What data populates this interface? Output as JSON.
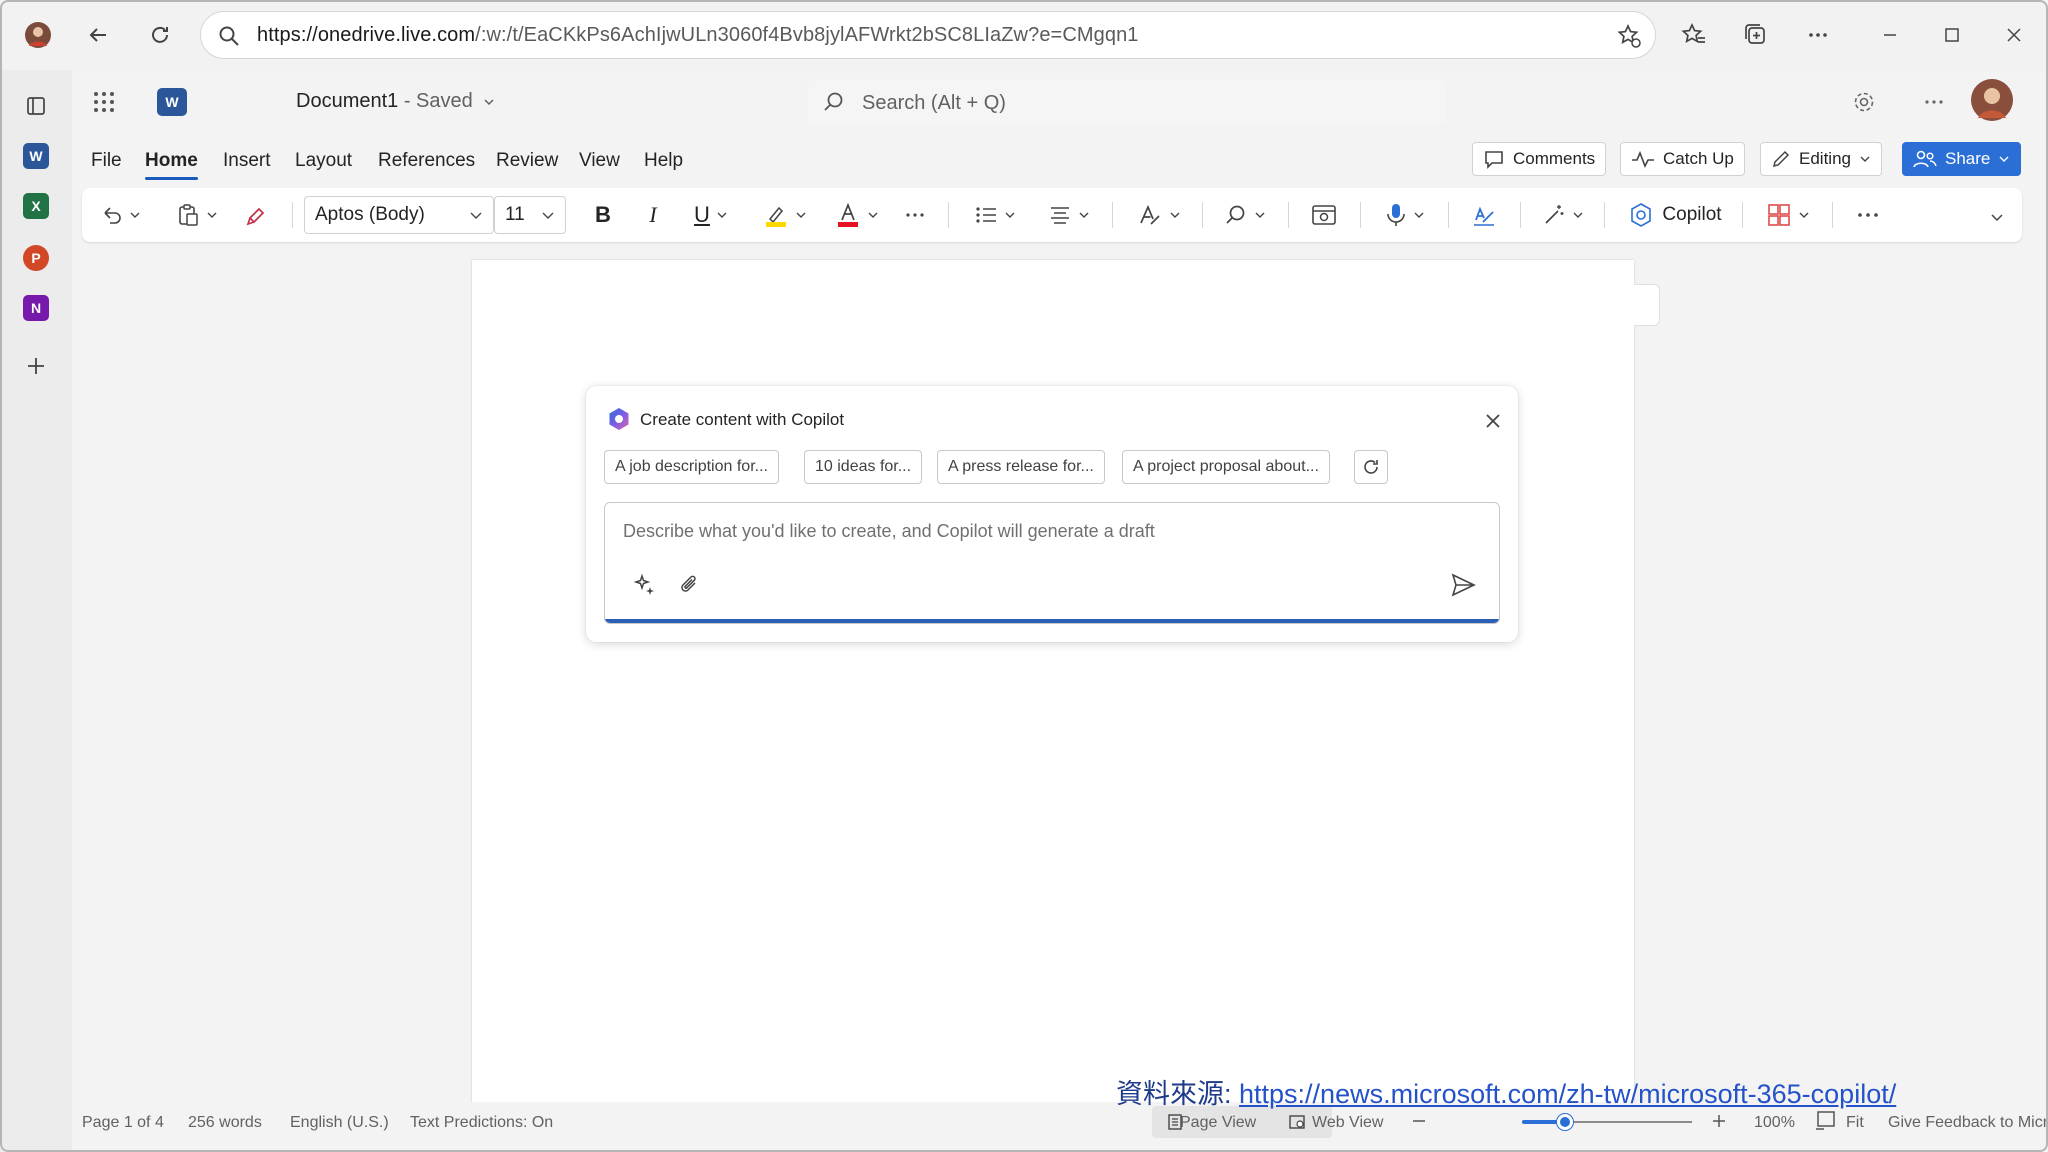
{
  "browser": {
    "url_domain": "https://onedrive.live.com",
    "url_path": "/:w:/t/EaCKkPs6AchIjwULn3060f4Bvb8jylAFWrkt2bSC8LIaZw?e=CMgqn1"
  },
  "word": {
    "doc_name": "Document1",
    "doc_status": "- Saved",
    "search_placeholder": "Search (Alt + Q)",
    "tabs": [
      "File",
      "Home",
      "Insert",
      "Layout",
      "References",
      "Review",
      "View",
      "Help"
    ],
    "active_tab": "Home",
    "header_buttons": {
      "comments": "Comments",
      "catch_up": "Catch Up",
      "editing": "Editing",
      "share": "Share"
    },
    "ribbon": {
      "font_name": "Aptos (Body)",
      "font_size": "11",
      "copilot_label": "Copilot",
      "bold": "B",
      "italic": "I",
      "underline": "U"
    }
  },
  "copilot": {
    "title": "Create content with Copilot",
    "suggestions": [
      "A job description for...",
      "10 ideas for...",
      "A press release for...",
      "A project proposal about..."
    ],
    "prompt_placeholder": "Describe what you'd like to create, and Copilot will generate a draft"
  },
  "status_bar": {
    "page": "Page 1 of 4",
    "words": "256 words",
    "language": "English (U.S.)",
    "text_predictions": "Text Predictions: On",
    "page_view": "Page View",
    "web_view": "Web View",
    "zoom": "100%",
    "zoom_fraction": 0.25,
    "fit": "Fit",
    "feedback": "Give Feedback to Microsoft"
  },
  "source": {
    "prefix": "資料來源: ",
    "url": "https://news.microsoft.com/zh-tw/microsoft-365-copilot/"
  },
  "colors": {
    "accent": "#185abd",
    "share_button": "#2b6fd6",
    "word": "#2b579a",
    "excel": "#217346",
    "powerpoint": "#d24726",
    "onenote": "#7719aa"
  }
}
